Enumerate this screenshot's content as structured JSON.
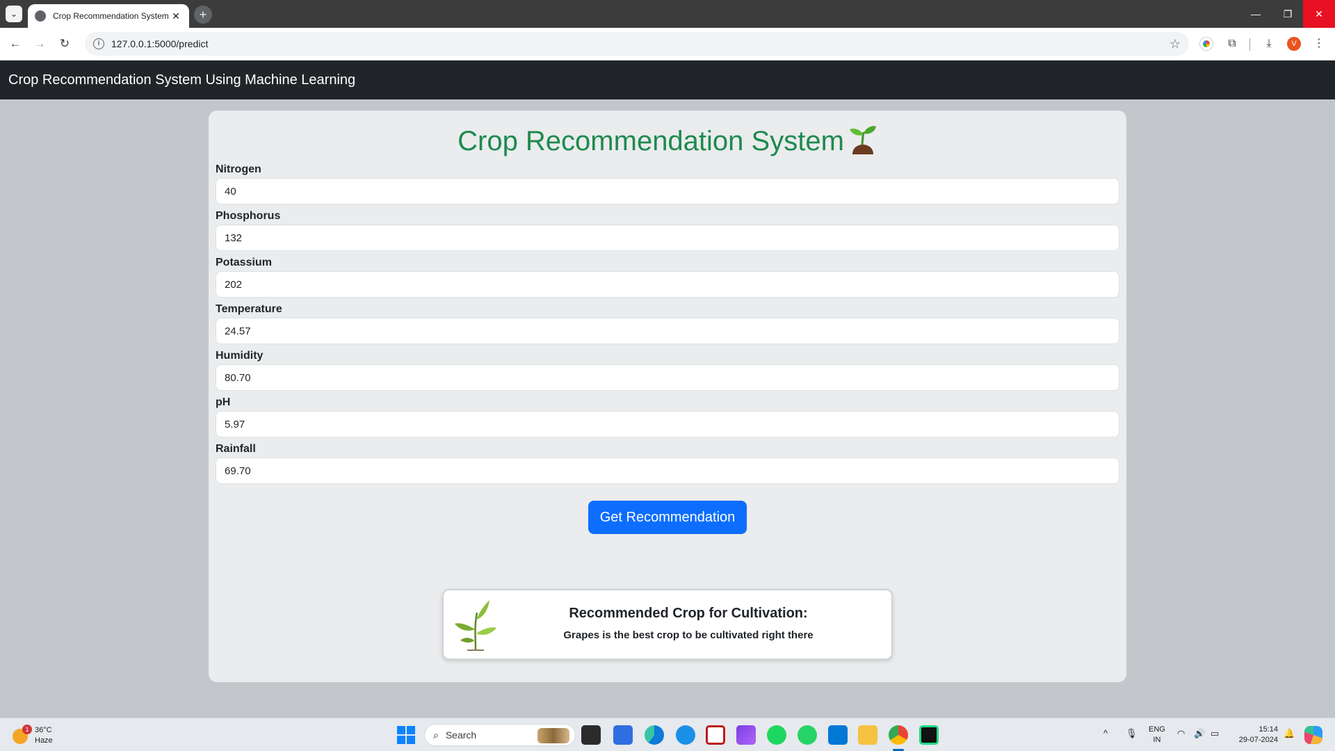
{
  "browser": {
    "tab_title": "Crop Recommendation System",
    "url": "127.0.0.1:5000/predict",
    "avatar_initial": "V"
  },
  "site": {
    "brand": "Crop Recommendation System Using Machine Learning"
  },
  "form": {
    "title": "Crop Recommendation System",
    "fields": [
      {
        "label": "Nitrogen",
        "value": "40"
      },
      {
        "label": "Phosphorus",
        "value": "132"
      },
      {
        "label": "Potassium",
        "value": "202"
      },
      {
        "label": "Temperature",
        "value": "24.57"
      },
      {
        "label": "Humidity",
        "value": "80.70"
      },
      {
        "label": "pH",
        "value": "5.97"
      },
      {
        "label": "Rainfall",
        "value": "69.70"
      }
    ],
    "submit_label": "Get Recommendation"
  },
  "result": {
    "title": "Recommended Crop for Cultivation:",
    "text": "Grapes is the best crop to be cultivated right there"
  },
  "taskbar": {
    "weather_temp": "36°C",
    "weather_condition": "Haze",
    "weather_badge": "1",
    "search_placeholder": "Search",
    "lang_line1": "ENG",
    "lang_line2": "IN",
    "time": "15:14",
    "date": "29-07-2024"
  },
  "colors": {
    "title_green": "#1e8a4f",
    "button_blue": "#0d6efd",
    "navbar_dark": "#212529"
  }
}
